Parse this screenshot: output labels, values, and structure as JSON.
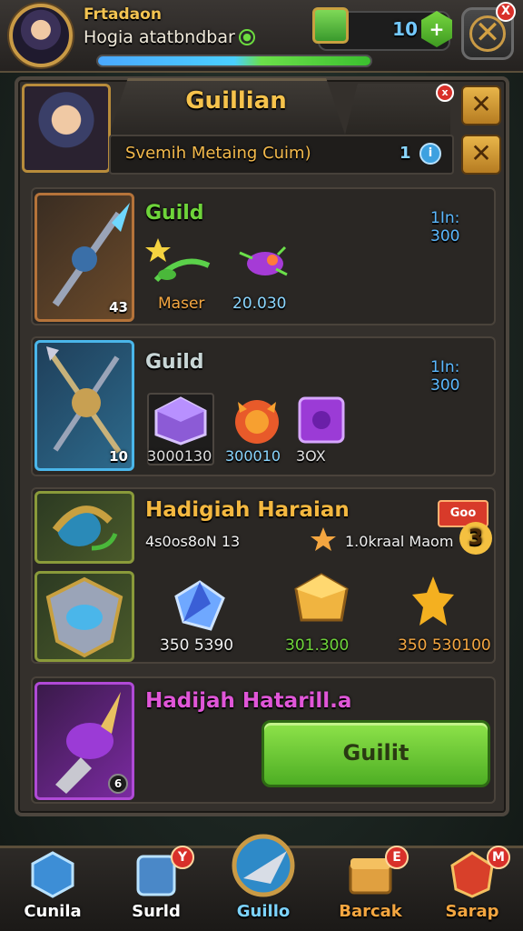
{
  "player": {
    "title": "Frtadaon",
    "subtitle": "Hogia atatbndbar",
    "xp_progress": 1.0
  },
  "currency": {
    "chest_count": "10",
    "plus_symbol": "+"
  },
  "window": {
    "close_symbol": "✕",
    "badge": "X"
  },
  "guild": {
    "name": "Guillian",
    "subtitle": "Svemih Metaing Cuim)",
    "member_count": "1",
    "info_symbol": "i",
    "header_close": "✕",
    "sub_close": "✕",
    "header_badge": "x"
  },
  "rows": [
    {
      "title": "Guild",
      "time": "1In: 300",
      "level": "43",
      "label_a": "Maser",
      "value_b": "20.030"
    },
    {
      "title": "Guild",
      "time": "1In: 300",
      "level": "10",
      "values": [
        "3000130",
        "300010",
        "3OX"
      ]
    },
    {
      "title": "Hadigiah Haraian",
      "sub_left": "4s0os8oN 13",
      "sub_right": "1.0kraal Maom",
      "badge_num": "3",
      "badge_text": "Goo",
      "values": [
        "350 5390",
        "301.300",
        "350 530100"
      ]
    },
    {
      "title": "Hadijah Hatarill.a",
      "button_label": "Guilit",
      "level": "6"
    }
  ],
  "nav": [
    {
      "label": "Cunila",
      "badge": "",
      "color": "#ffffff"
    },
    {
      "label": "Surld",
      "badge": "Y",
      "color": "#ffffff"
    },
    {
      "label": "Guillo",
      "badge": "",
      "color": "#7cd3ff"
    },
    {
      "label": "Barcak",
      "badge": "E",
      "color": "#f4a640"
    },
    {
      "label": "Sarap",
      "badge": "M",
      "color": "#f4a640"
    }
  ]
}
